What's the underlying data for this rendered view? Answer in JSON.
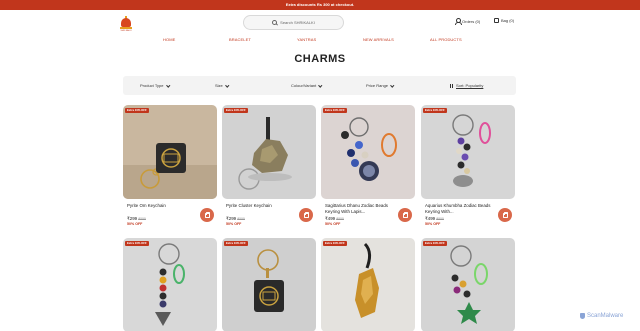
{
  "promo": {
    "text": "Extra discounts Rs 300 at checkout."
  },
  "header": {
    "logo_alt": "SHRI KALKI",
    "search_placeholder": "Search SHRIKALKI",
    "orders": "Orders (0)",
    "bag": "Bag (0)"
  },
  "nav": [
    "HOME",
    "BRACELET",
    "YANTRAS",
    "NEW ARRIVALS",
    "ALL PRODUCTS"
  ],
  "page_title": "CHARMS",
  "filters": {
    "product_type": "Product Type",
    "size": "Size",
    "colour": "Colour/Variant",
    "price": "Price Range",
    "sort": "Sort: Popularity"
  },
  "products": [
    {
      "badge": "Extra 10% OFF",
      "name": "Pyrite Om Keychain",
      "price": "₹299",
      "mrp": "₹599",
      "off": "50% OFF"
    },
    {
      "badge": "Extra 10% OFF",
      "name": "Pyrite Cluster Keychain",
      "price": "₹299",
      "mrp": "₹599",
      "off": "50% OFF"
    },
    {
      "badge": "Extra 10% OFF",
      "name": "Sagittarius Dhanu Zodiac Beads Keyring With Lapis...",
      "price": "₹499",
      "mrp": "₹999",
      "off": "50% OFF"
    },
    {
      "badge": "Extra 10% OFF",
      "name": "Aquarius Khumbha Zodiac Beads Keyring With...",
      "price": "₹499",
      "mrp": "₹999",
      "off": "50% OFF"
    },
    {
      "badge": "Extra 10% OFF"
    },
    {
      "badge": "Extra 10% OFF"
    },
    {
      "badge": "Extra 10% OFF"
    },
    {
      "badge": "Extra 10% OFF"
    }
  ],
  "watermark": "ScanMalware"
}
